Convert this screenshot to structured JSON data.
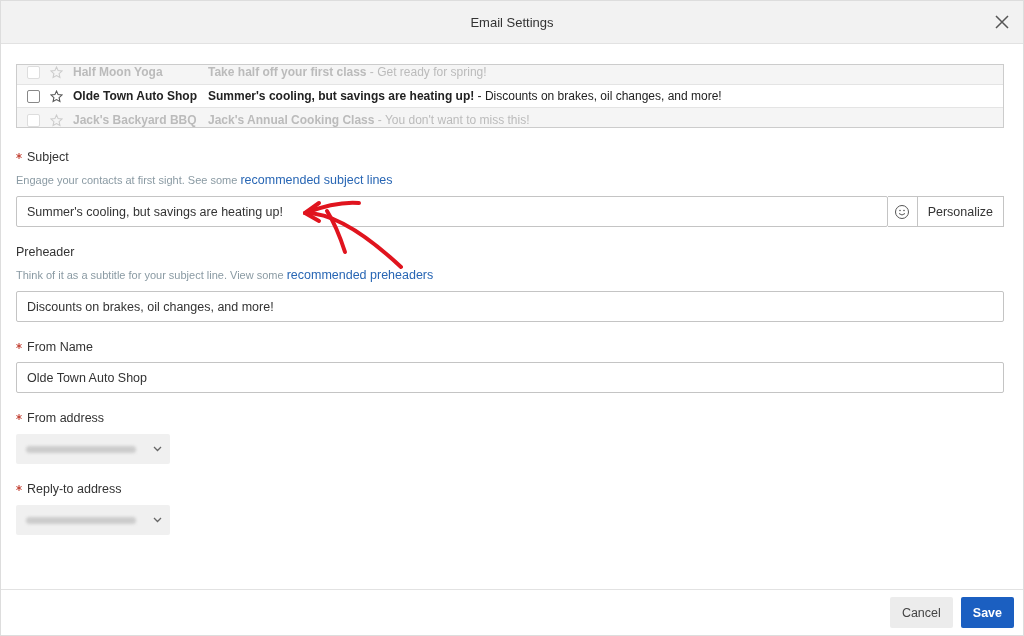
{
  "window": {
    "title": "Email Settings"
  },
  "inbox_preview": [
    {
      "kind": "faded",
      "checked": false,
      "sender": "Half Moon Yoga",
      "subject": "Take half off your first class",
      "snippet": "- Get ready for spring!"
    },
    {
      "kind": "current",
      "checked": false,
      "sender": "Olde Town Auto Shop",
      "subject": "Summer's cooling, but savings are heating up!",
      "snippet": "- Discounts on brakes, oil changes, and more!"
    },
    {
      "kind": "faded",
      "checked": false,
      "sender": "Jack's Backyard BBQ",
      "subject": "Jack's Annual Cooking Class",
      "snippet": "- You don't want to miss this!"
    }
  ],
  "fields": [
    {
      "kind": "text_emoji",
      "label": "Subject",
      "required": true,
      "hint": "Engage your contacts at first sight. See some",
      "link": "recommended subject lines",
      "value": "Summer's cooling, but savings are heating up!",
      "button": "Personalize"
    },
    {
      "kind": "text",
      "label": "Preheader",
      "required": false,
      "hint": "Think of it as a subtitle for your subject line. View some",
      "link": "recommended preheaders",
      "value": "Discounts on brakes, oil changes, and more!"
    },
    {
      "kind": "text",
      "label": "From Name",
      "required": true,
      "value": "Olde Town Auto Shop"
    },
    {
      "kind": "select",
      "label": "From address",
      "required": true
    },
    {
      "kind": "select",
      "label": "Reply-to address",
      "required": true
    }
  ],
  "buttons": [
    {
      "kind": "secondary",
      "label": "Cancel"
    },
    {
      "kind": "primary",
      "label": "Save"
    }
  ]
}
